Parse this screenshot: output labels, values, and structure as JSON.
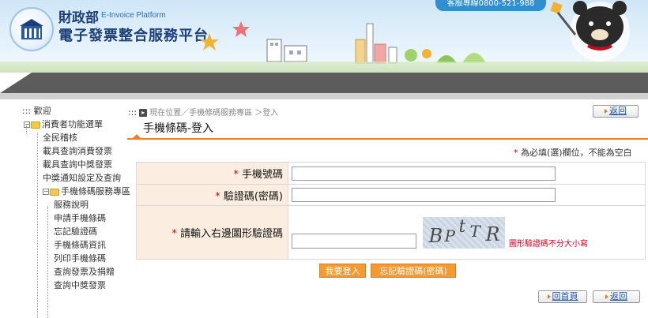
{
  "header": {
    "ministry": "財政部",
    "platform_en": "E-Invoice Platform",
    "platform_zh": "電子發票整合服務平台",
    "hotline": "客服專線0800-521-988"
  },
  "sidebar": {
    "welcome": "::: 歡迎",
    "root": "消費者功能選單",
    "items": [
      "全民稽核",
      "載具查詢消費發票",
      "載具查詢中獎發票",
      "中獎通知設定及查詢"
    ],
    "sub_root": "手機條碼服務專區",
    "sub_items": [
      "服務說明",
      "申請手機條碼",
      "忘記驗證碼",
      "手機條碼資訊",
      "列印手機條碼",
      "查詢發票及捐贈",
      "查詢中獎發票"
    ]
  },
  "breadcrumb": {
    "prefix": ":::",
    "location": "現在位置",
    "path": "／手機條碼服務專區 ＞登入"
  },
  "top_back": "返回",
  "page_title": "手機條碼-登入",
  "required_note": "為必填(選)欄位，不能為空白",
  "required_star": "*",
  "form": {
    "phone_label": "手機號碼",
    "code_label": "驗證碼(密碼)",
    "captcha_label": "請輸入右邊圖形驗證碼",
    "captcha_text": "BPtTR",
    "captcha_note": "圖形驗證碼不分大小寫"
  },
  "buttons": {
    "login": "我要登入",
    "forgot": "忘記驗證碼(密碼)",
    "home": "回首頁",
    "back": "返回"
  },
  "colors": {
    "accent": "#e7812a",
    "required": "#d0021b",
    "label_bg": "#fbeee0",
    "link": "#1f4fa3"
  }
}
